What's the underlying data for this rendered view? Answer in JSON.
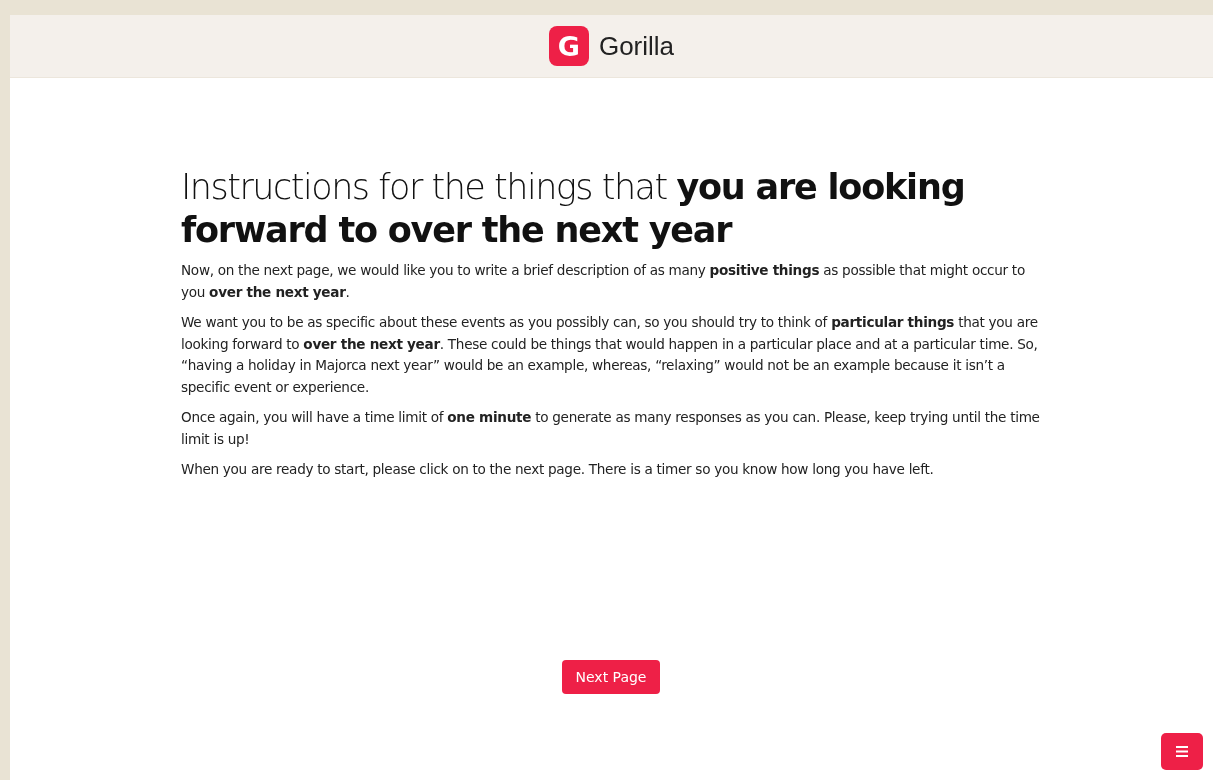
{
  "header": {
    "logo_letter": "G",
    "brand": "Gorilla"
  },
  "title": "Instructions for the things that **you are looking forward to over the next year**",
  "paragraphs": [
    "Now, on the next page, we would like you to write a brief description of as many **positive things** as possible that might occur to you **over the next year**.",
    "We want you to be as specific about these events as you possibly can, so you should try to think of **particular things** that you are looking forward to **over the next year**. These could be things that would happen in a particular place and at a particular time. So, “having a holiday in Majorca next year” would be an example, whereas, “relaxing” would not be an example because it isn’t a specific event or experience.",
    "Once again, you will have a time limit of **one minute** to generate as many responses as you can. Please, keep trying until the time limit is up!",
    "When you are ready to start, please click on to the next page. There is a timer so you know how long you have left."
  ],
  "next_button": "Next Page"
}
